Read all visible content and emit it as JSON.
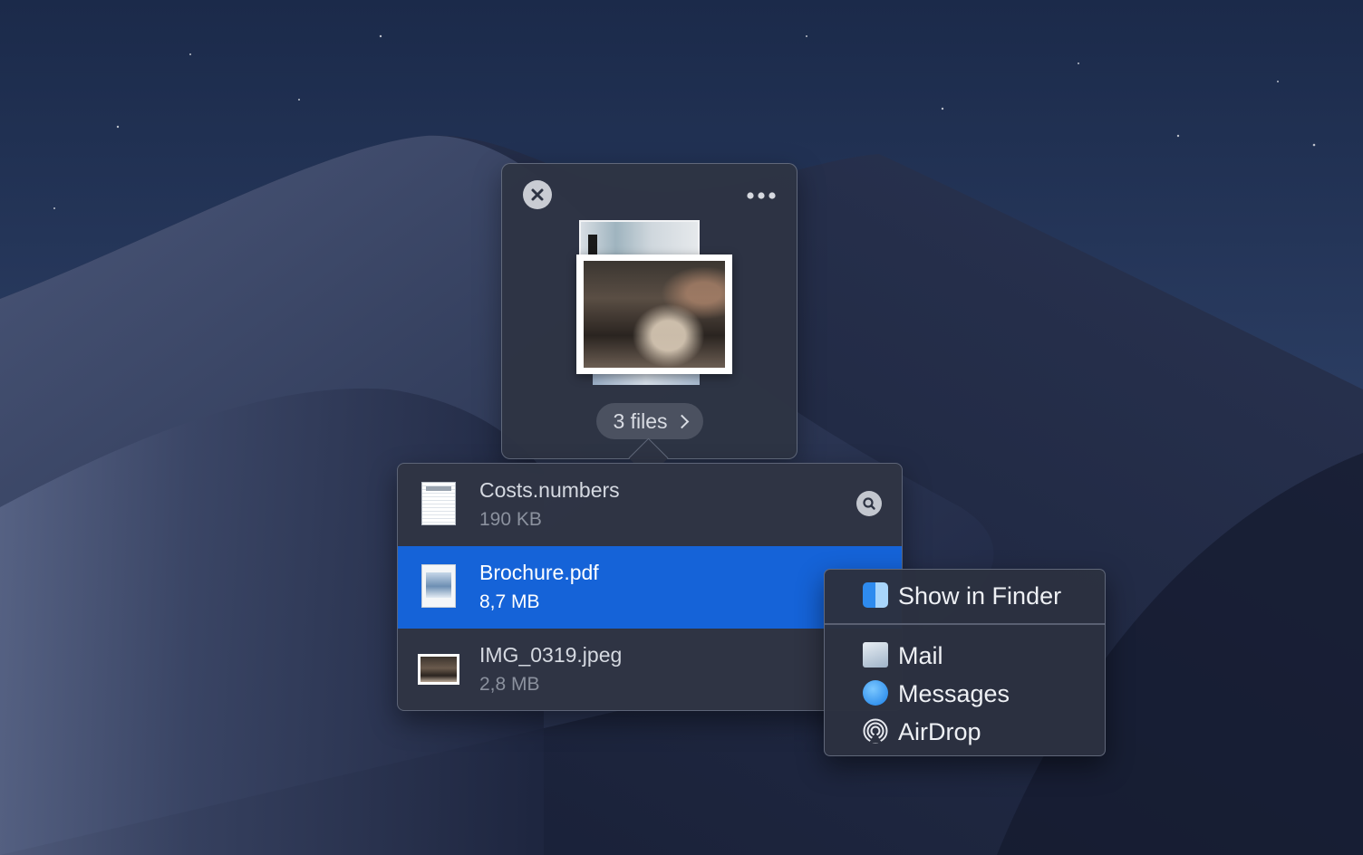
{
  "stack": {
    "files_label": "3 files",
    "close_icon": "close-icon",
    "more_icon": "ellipsis-icon"
  },
  "files": [
    {
      "name": "Costs.numbers",
      "size": "190 KB",
      "icon": "numbers-file-icon",
      "selected": false
    },
    {
      "name": "Brochure.pdf",
      "size": "8,7 MB",
      "icon": "pdf-file-icon",
      "selected": true
    },
    {
      "name": "IMG_0319.jpeg",
      "size": "2,8 MB",
      "icon": "jpeg-file-icon",
      "selected": false
    }
  ],
  "menu": {
    "show_in_finder": "Show in Finder",
    "items": [
      {
        "label": "Mail",
        "icon": "mail-icon"
      },
      {
        "label": "Messages",
        "icon": "messages-icon"
      },
      {
        "label": "AirDrop",
        "icon": "airdrop-icon"
      }
    ]
  },
  "colors": {
    "selection": "#1563d8",
    "panel": "#2e3444",
    "sky": "#1d2a45"
  }
}
